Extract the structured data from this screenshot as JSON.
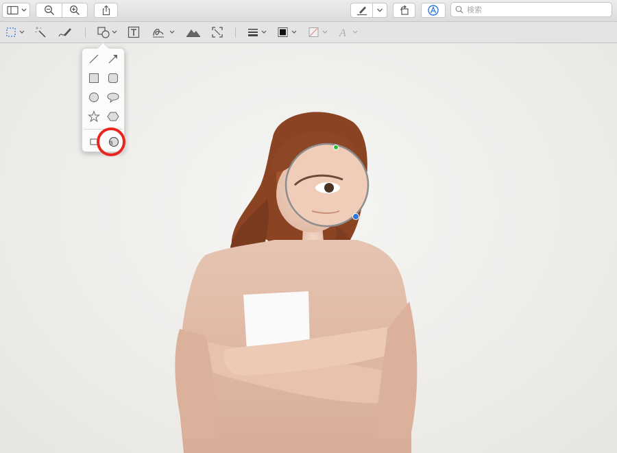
{
  "toolbar": {
    "sidebar_button": "sidebar-icon",
    "zoom_out_button": "zoom-out-icon",
    "zoom_in_button": "zoom-in-icon",
    "share_button": "share-icon",
    "markup_button": "pen-icon",
    "rotate_button": "rotate-icon",
    "annotate_button": "markup-toolbar-icon",
    "search_placeholder": "検索"
  },
  "markup_toolbar": {
    "tools": [
      "selection-tool",
      "instant-alpha-tool",
      "sketch-tool",
      "shapes-tool",
      "text-tool",
      "sign-tool",
      "adjust-color-tool",
      "adjust-size-tool",
      "line-style-tool",
      "border-color-tool",
      "fill-color-tool",
      "text-style-tool"
    ]
  },
  "shapes_popover": {
    "items": [
      "line-shape",
      "arrow-shape",
      "rectangle-shape",
      "rounded-rectangle-shape",
      "oval-shape",
      "speech-bubble-shape",
      "star-shape",
      "hexagon-shape",
      "mask-shape",
      "loupe-shape"
    ],
    "highlighted": "loupe-shape"
  },
  "colors": {
    "highlight": "#e8261f",
    "loupe_handle_top": "#2fbe3a",
    "loupe_handle_bottom": "#2f7ad8"
  }
}
